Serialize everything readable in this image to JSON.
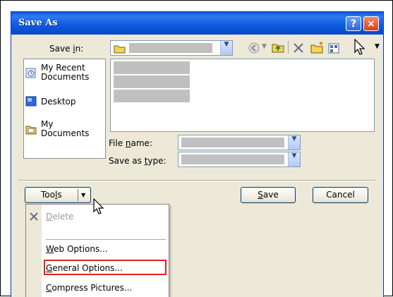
{
  "dialog": {
    "title": "Save As",
    "help_glyph": "?",
    "close_glyph": "×"
  },
  "toolbar": {
    "save_in_label": "Save in:",
    "save_in_underline": "i",
    "icons": [
      "back-icon",
      "up-folder-icon",
      "delete-icon",
      "new-folder-icon",
      "views-icon"
    ]
  },
  "places": [
    {
      "label_line1": "My Recent",
      "label_line2": "Documents",
      "icon": "recent-documents-icon"
    },
    {
      "label_line1": "Desktop",
      "label_line2": "",
      "icon": "desktop-icon"
    },
    {
      "label_line1": "My",
      "label_line2": "Documents",
      "icon": "my-documents-icon"
    }
  ],
  "fields": {
    "file_name_label": "File name:",
    "save_as_type_label": "Save as type:"
  },
  "buttons": {
    "tools": "Tools",
    "save": "Save",
    "cancel": "Cancel"
  },
  "tools_menu": {
    "items": [
      {
        "label": "Delete",
        "enabled": false
      },
      {
        "label": "Web Options...",
        "enabled": true
      },
      {
        "label": "General Options...",
        "enabled": true,
        "highlighted": true
      },
      {
        "label": "Compress Pictures...",
        "enabled": true
      }
    ]
  },
  "colors": {
    "titlebar": "#0a5ad9",
    "dialog_bg": "#ece9d8",
    "highlight_box": "#e02020",
    "redacted": "#c0c0c0"
  }
}
